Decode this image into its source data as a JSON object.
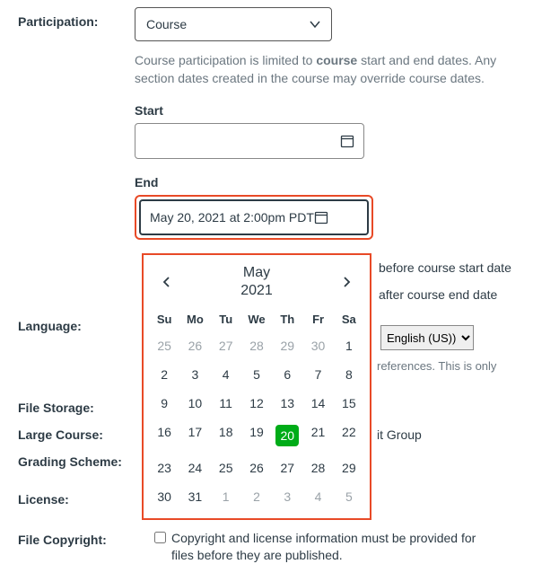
{
  "participation": {
    "label": "Participation:",
    "selected": "Course",
    "helper_pre": "Course participation is limited to ",
    "helper_bold": "course",
    "helper_post": " start and end dates. Any section dates created in the course may override course dates.",
    "start_label": "Start",
    "start_value": "",
    "end_label": "End",
    "end_value": "May 20, 2021 at 2:00pm PDT"
  },
  "restrict": {
    "before": "before course start date",
    "after": "after course end date"
  },
  "language": {
    "label": "Language:",
    "selected": "English (US))",
    "hint": "references. This is only"
  },
  "labels": {
    "file_storage": "File Storage:",
    "large_course": "Large Course:",
    "grading_scheme": "Grading Scheme:",
    "license": "License:",
    "file_copyright": "File Copyright:"
  },
  "behind": {
    "group_fragment": "it Group"
  },
  "copyright": {
    "text": "Copyright and license information must be provided for files before they are published."
  },
  "calendar": {
    "month": "May",
    "year": "2021",
    "dow": [
      "Su",
      "Mo",
      "Tu",
      "We",
      "Th",
      "Fr",
      "Sa"
    ],
    "days": [
      {
        "n": 25,
        "out": true
      },
      {
        "n": 26,
        "out": true
      },
      {
        "n": 27,
        "out": true
      },
      {
        "n": 28,
        "out": true
      },
      {
        "n": 29,
        "out": true
      },
      {
        "n": 30,
        "out": true
      },
      {
        "n": 1
      },
      {
        "n": 2
      },
      {
        "n": 3
      },
      {
        "n": 4
      },
      {
        "n": 5
      },
      {
        "n": 6
      },
      {
        "n": 7
      },
      {
        "n": 8
      },
      {
        "n": 9
      },
      {
        "n": 10
      },
      {
        "n": 11
      },
      {
        "n": 12
      },
      {
        "n": 13
      },
      {
        "n": 14
      },
      {
        "n": 15
      },
      {
        "n": 16
      },
      {
        "n": 17
      },
      {
        "n": 18
      },
      {
        "n": 19
      },
      {
        "n": 20,
        "sel": true
      },
      {
        "n": 21
      },
      {
        "n": 22
      },
      {
        "n": 23
      },
      {
        "n": 24
      },
      {
        "n": 25
      },
      {
        "n": 26
      },
      {
        "n": 27
      },
      {
        "n": 28
      },
      {
        "n": 29
      },
      {
        "n": 30
      },
      {
        "n": 31
      },
      {
        "n": 1,
        "out": true
      },
      {
        "n": 2,
        "out": true
      },
      {
        "n": 3,
        "out": true
      },
      {
        "n": 4,
        "out": true
      },
      {
        "n": 5,
        "out": true
      }
    ]
  }
}
